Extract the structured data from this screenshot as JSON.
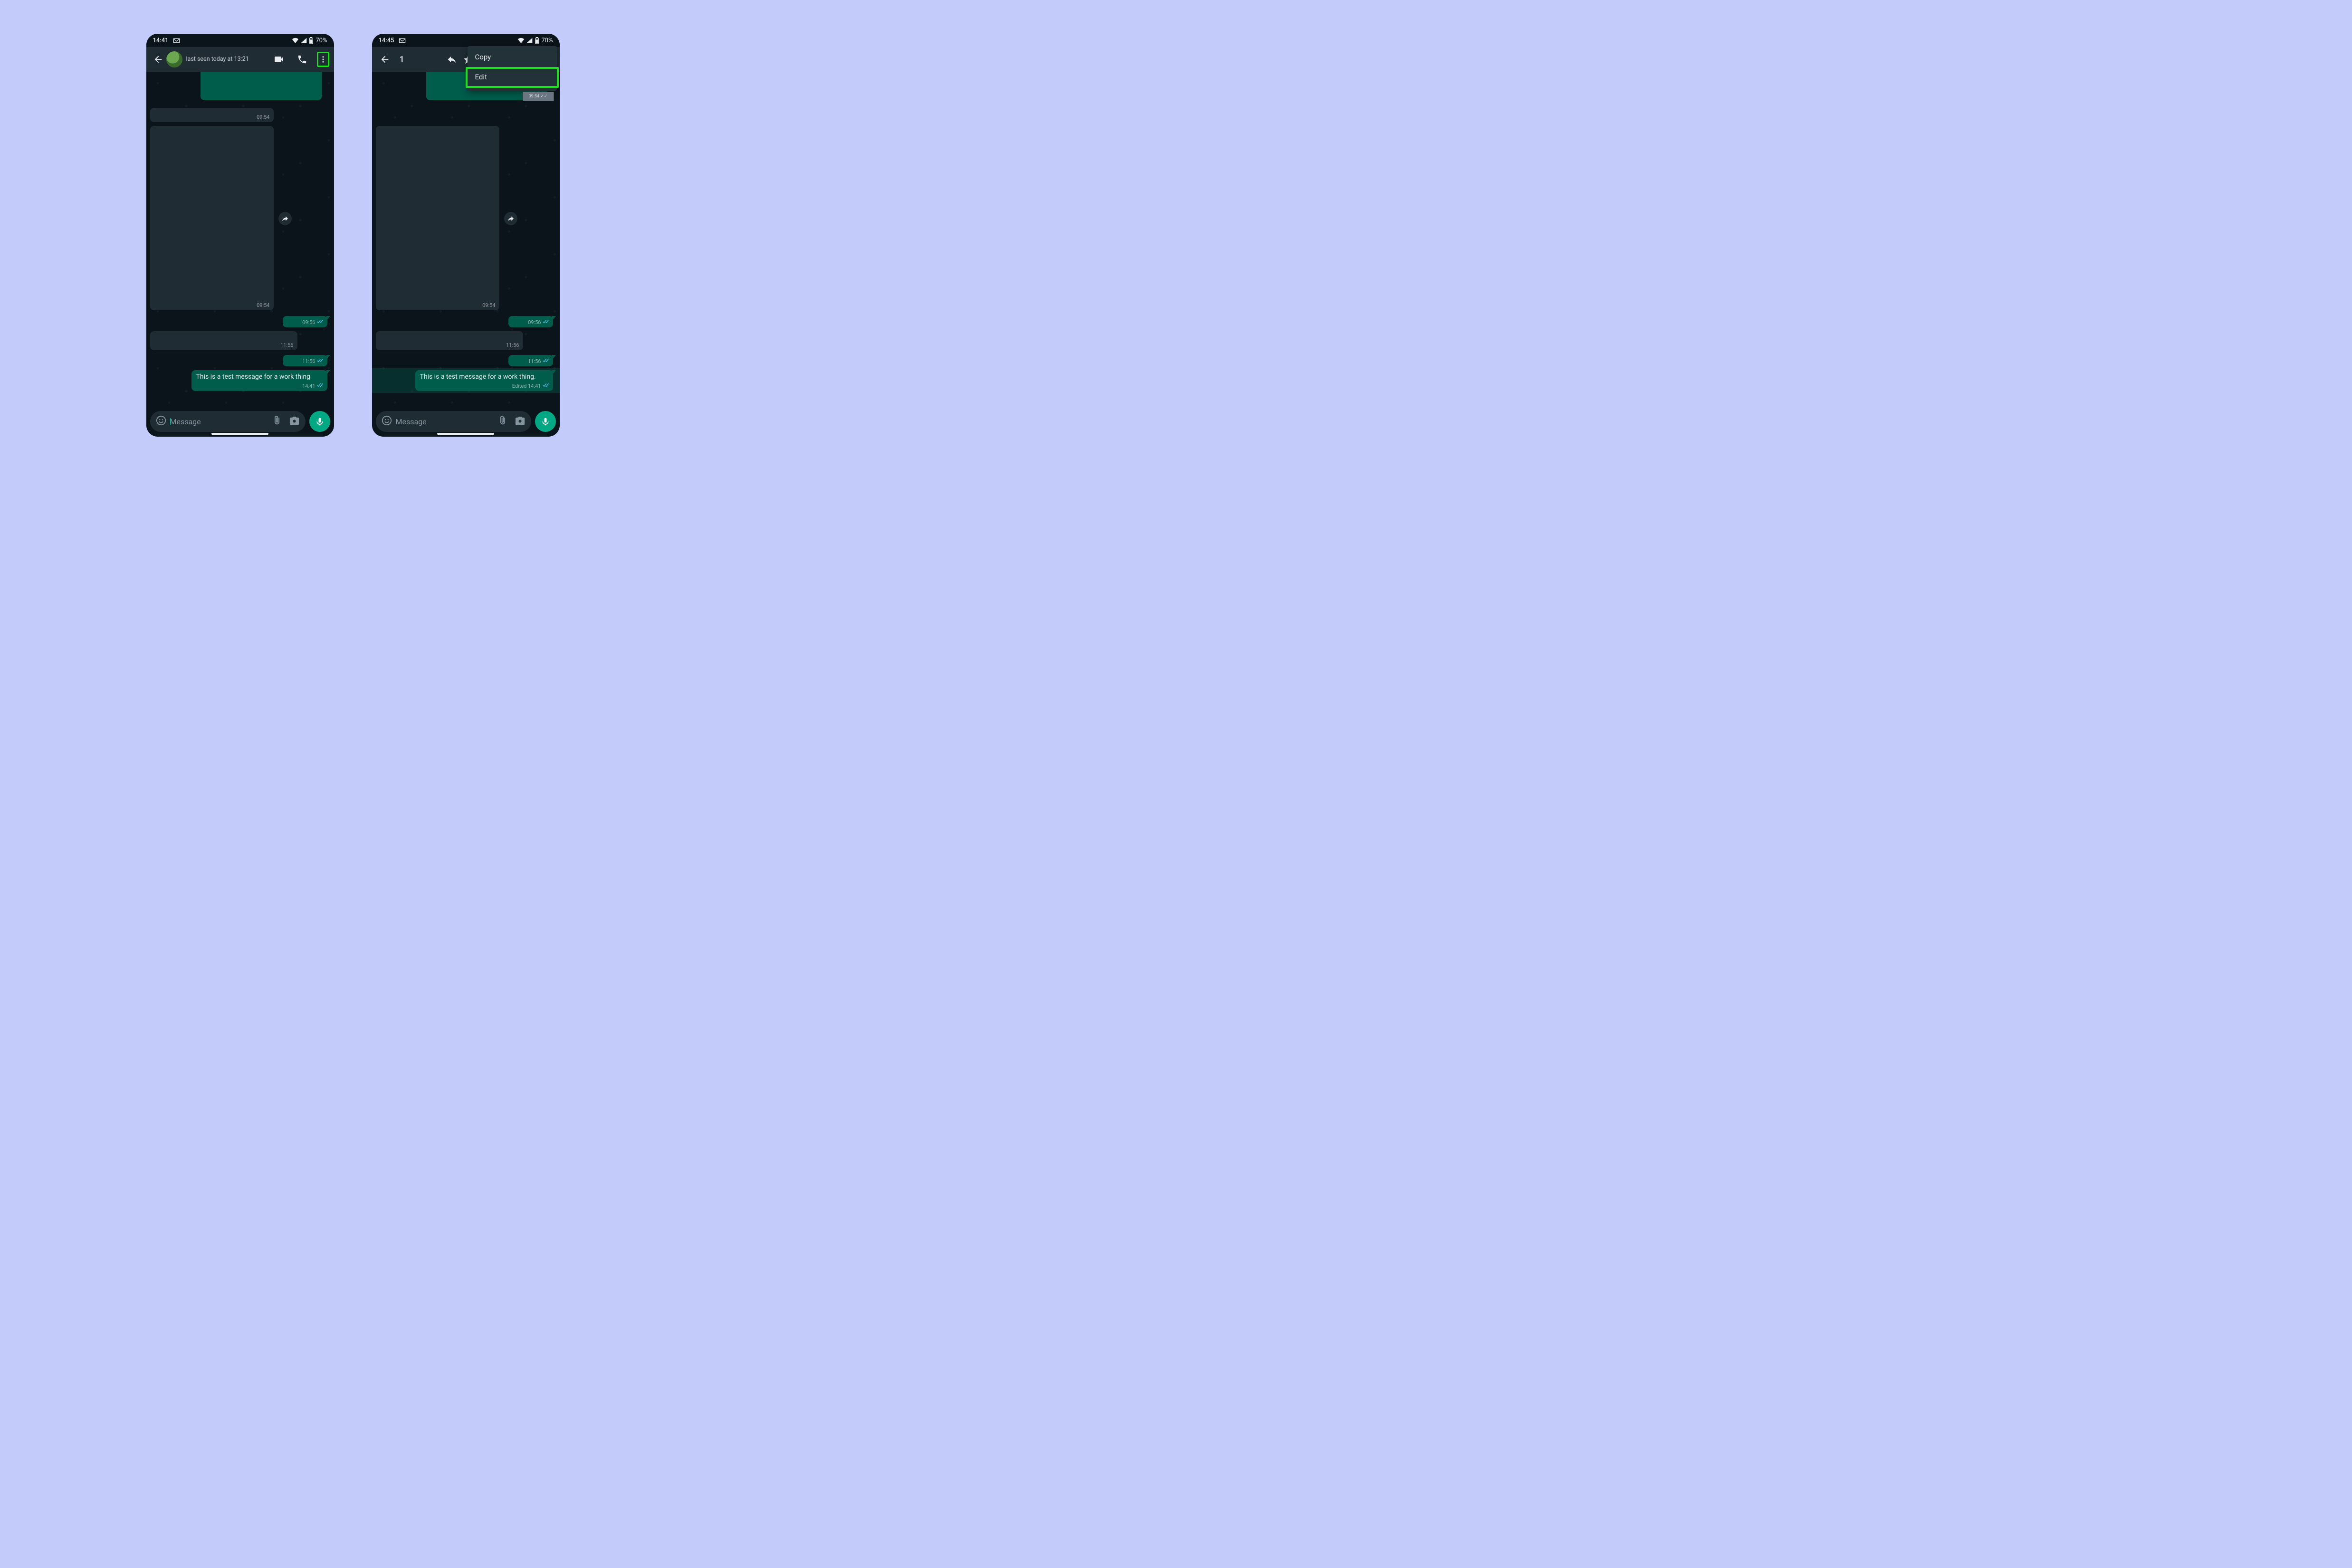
{
  "left": {
    "status": {
      "time": "14:41",
      "battery": "70%"
    },
    "header": {
      "subtitle": "last seen today at 13:21"
    },
    "msgs": {
      "img1_ts": "09:54",
      "ts_out1": "09:56",
      "ts_in1": "11:56",
      "ts_out2": "11:56",
      "test_text": "This is a test message for a work thing",
      "test_ts": "14:41"
    },
    "input": {
      "placeholder": "Message"
    }
  },
  "right": {
    "status": {
      "time": "14:45",
      "battery": "70%"
    },
    "header": {
      "count": "1"
    },
    "menu": {
      "copy": "Copy",
      "edit": "Edit"
    },
    "thumb_ts": "09:54",
    "msgs": {
      "img1_ts": "09:54",
      "ts_out1": "09:56",
      "ts_in1": "11:56",
      "ts_out2": "11:56",
      "test_text": "This is a test message for a work thing.",
      "test_meta": "Edited 14:41"
    },
    "input": {
      "placeholder": "Message"
    }
  }
}
